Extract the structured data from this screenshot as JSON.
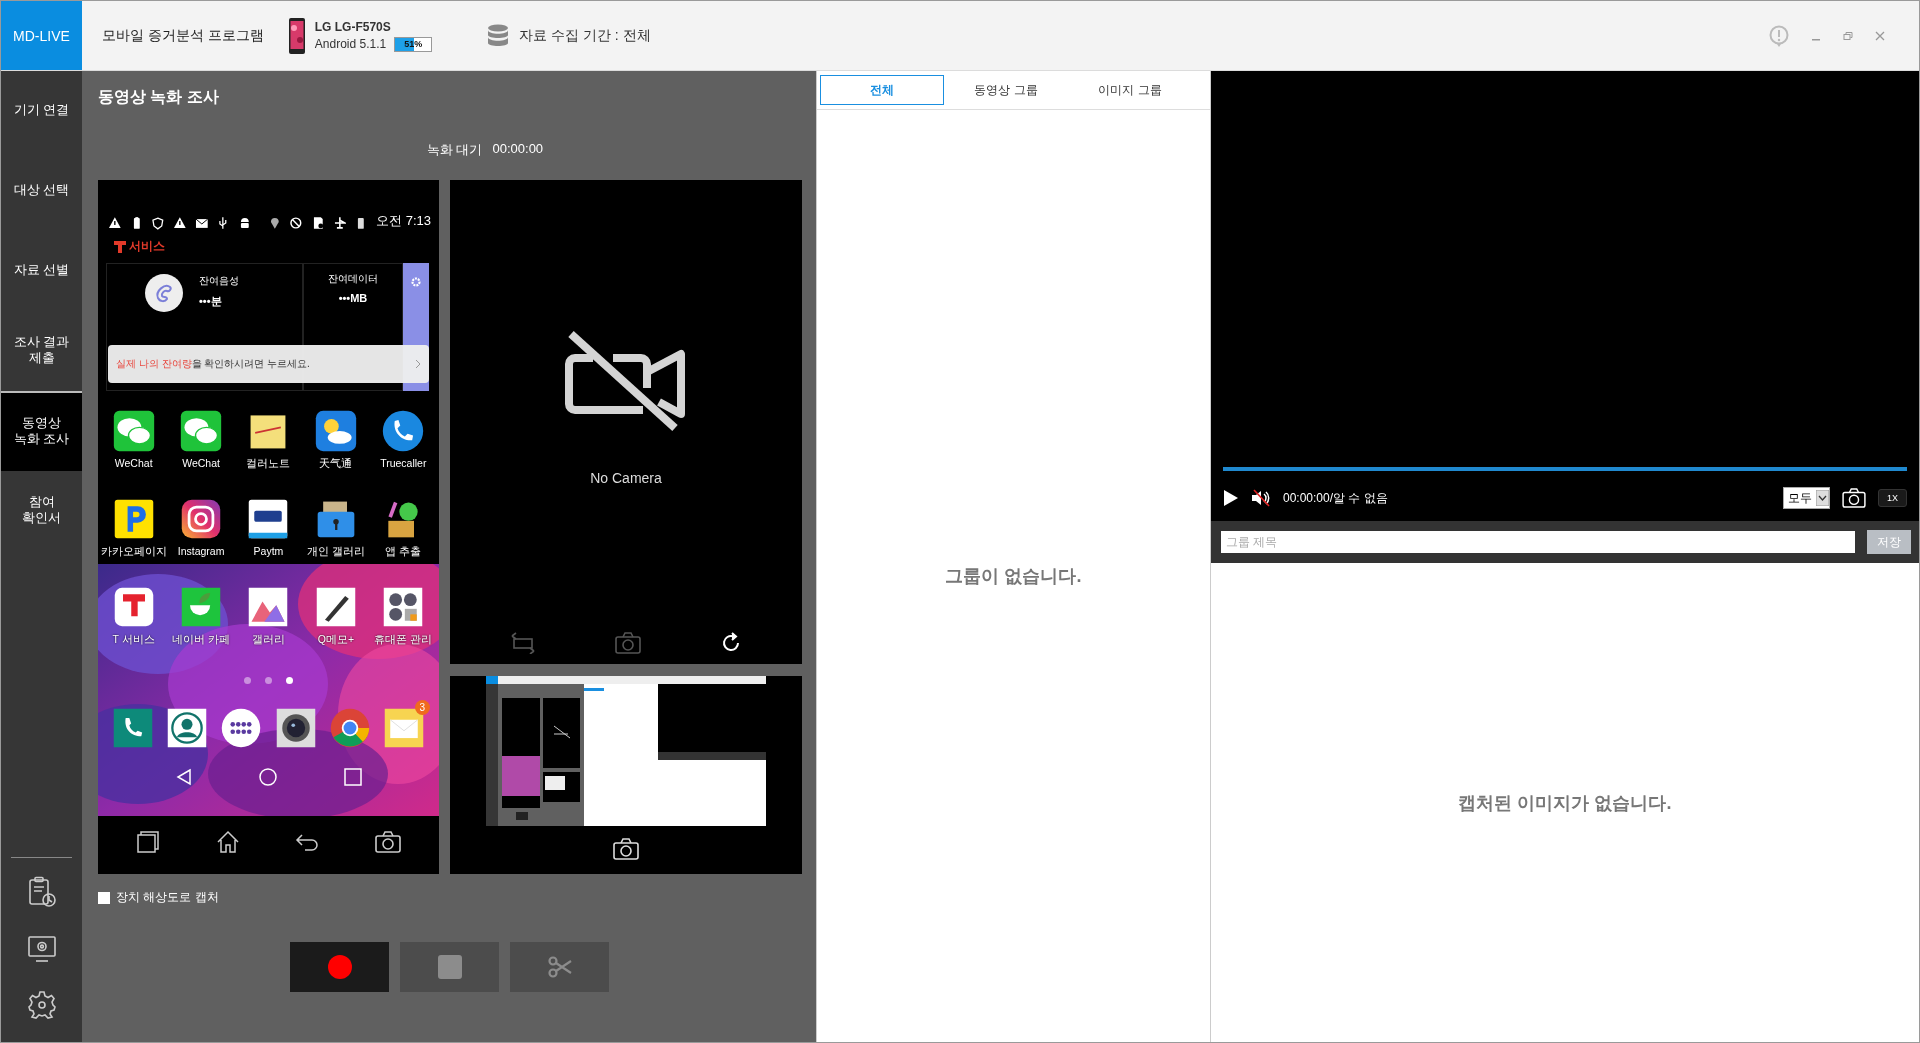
{
  "app": {
    "logo": "MD-LIVE",
    "title": "모바일 증거분석 프로그램"
  },
  "device": {
    "model": "LG LG-F570S",
    "os": "Android 5.1.1",
    "battery": "51%",
    "level": 0.51
  },
  "collection_period": "자료 수집 기간 : 전체",
  "sidebar": {
    "items": [
      {
        "label": "기기 연결",
        "selected": false
      },
      {
        "label": "대상 선택",
        "selected": false
      },
      {
        "label": "자료 선별",
        "selected": false
      },
      {
        "label": "조사 결과 제출",
        "selected": false
      },
      {
        "label": "동영상 녹화 조사",
        "selected": true
      },
      {
        "label": "참여 확인서",
        "selected": false
      }
    ]
  },
  "recorder": {
    "title": "동영상 녹화 조사",
    "status": "녹화 대기",
    "time": "00:00:00",
    "phone": {
      "clock": "오전 7:13",
      "carrier": "서비스",
      "voice_label": "잔여음성",
      "voice_value": "•••분",
      "data_label": "잔여데이터",
      "data_value": "•••MB",
      "banner": "**실제 나의 잔여량**을 확인하시려면 누르세요.",
      "apps": [
        {
          "label": "WeChat"
        },
        {
          "label": "WeChat"
        },
        {
          "label": "컬러노트"
        },
        {
          "label": "天气通"
        },
        {
          "label": "Truecaller"
        },
        {
          "label": "카카오페이지"
        },
        {
          "label": "Instagram"
        },
        {
          "label": "Paytm"
        },
        {
          "label": "개인 갤러리"
        },
        {
          "label": "앱 추출"
        },
        {
          "label": "T 서비스"
        },
        {
          "label": "네이버 카페"
        },
        {
          "label": "갤러리"
        },
        {
          "label": "Q메모+"
        },
        {
          "label": "휴대폰 관리"
        }
      ],
      "page_dots": [
        {
          "selected": false
        },
        {
          "selected": false
        },
        {
          "selected": true
        }
      ],
      "dock_badge": "3"
    },
    "camera": {
      "message": "No Camera"
    },
    "capture_option": {
      "label": "장치 해상도로 캡처",
      "checked": false
    },
    "buttons": [
      {
        "kind": "record",
        "disabled": false
      },
      {
        "kind": "stop",
        "disabled": true
      },
      {
        "kind": "cut",
        "disabled": true
      }
    ]
  },
  "groups": {
    "tabs": [
      {
        "label": "전체",
        "selected": true
      },
      {
        "label": "동영상 그룹",
        "selected": false
      },
      {
        "label": "이미지 그룹",
        "selected": false
      }
    ],
    "empty_message": "그룹이 없습니다."
  },
  "player": {
    "level": 1,
    "muted": true,
    "time": "00:00:00/알 수 없음",
    "filter": "모두",
    "speed": "1X"
  },
  "capture": {
    "placeholder": "그룹 제목",
    "save": "저장",
    "empty_message": "캡처된 이미지가 없습니다."
  }
}
